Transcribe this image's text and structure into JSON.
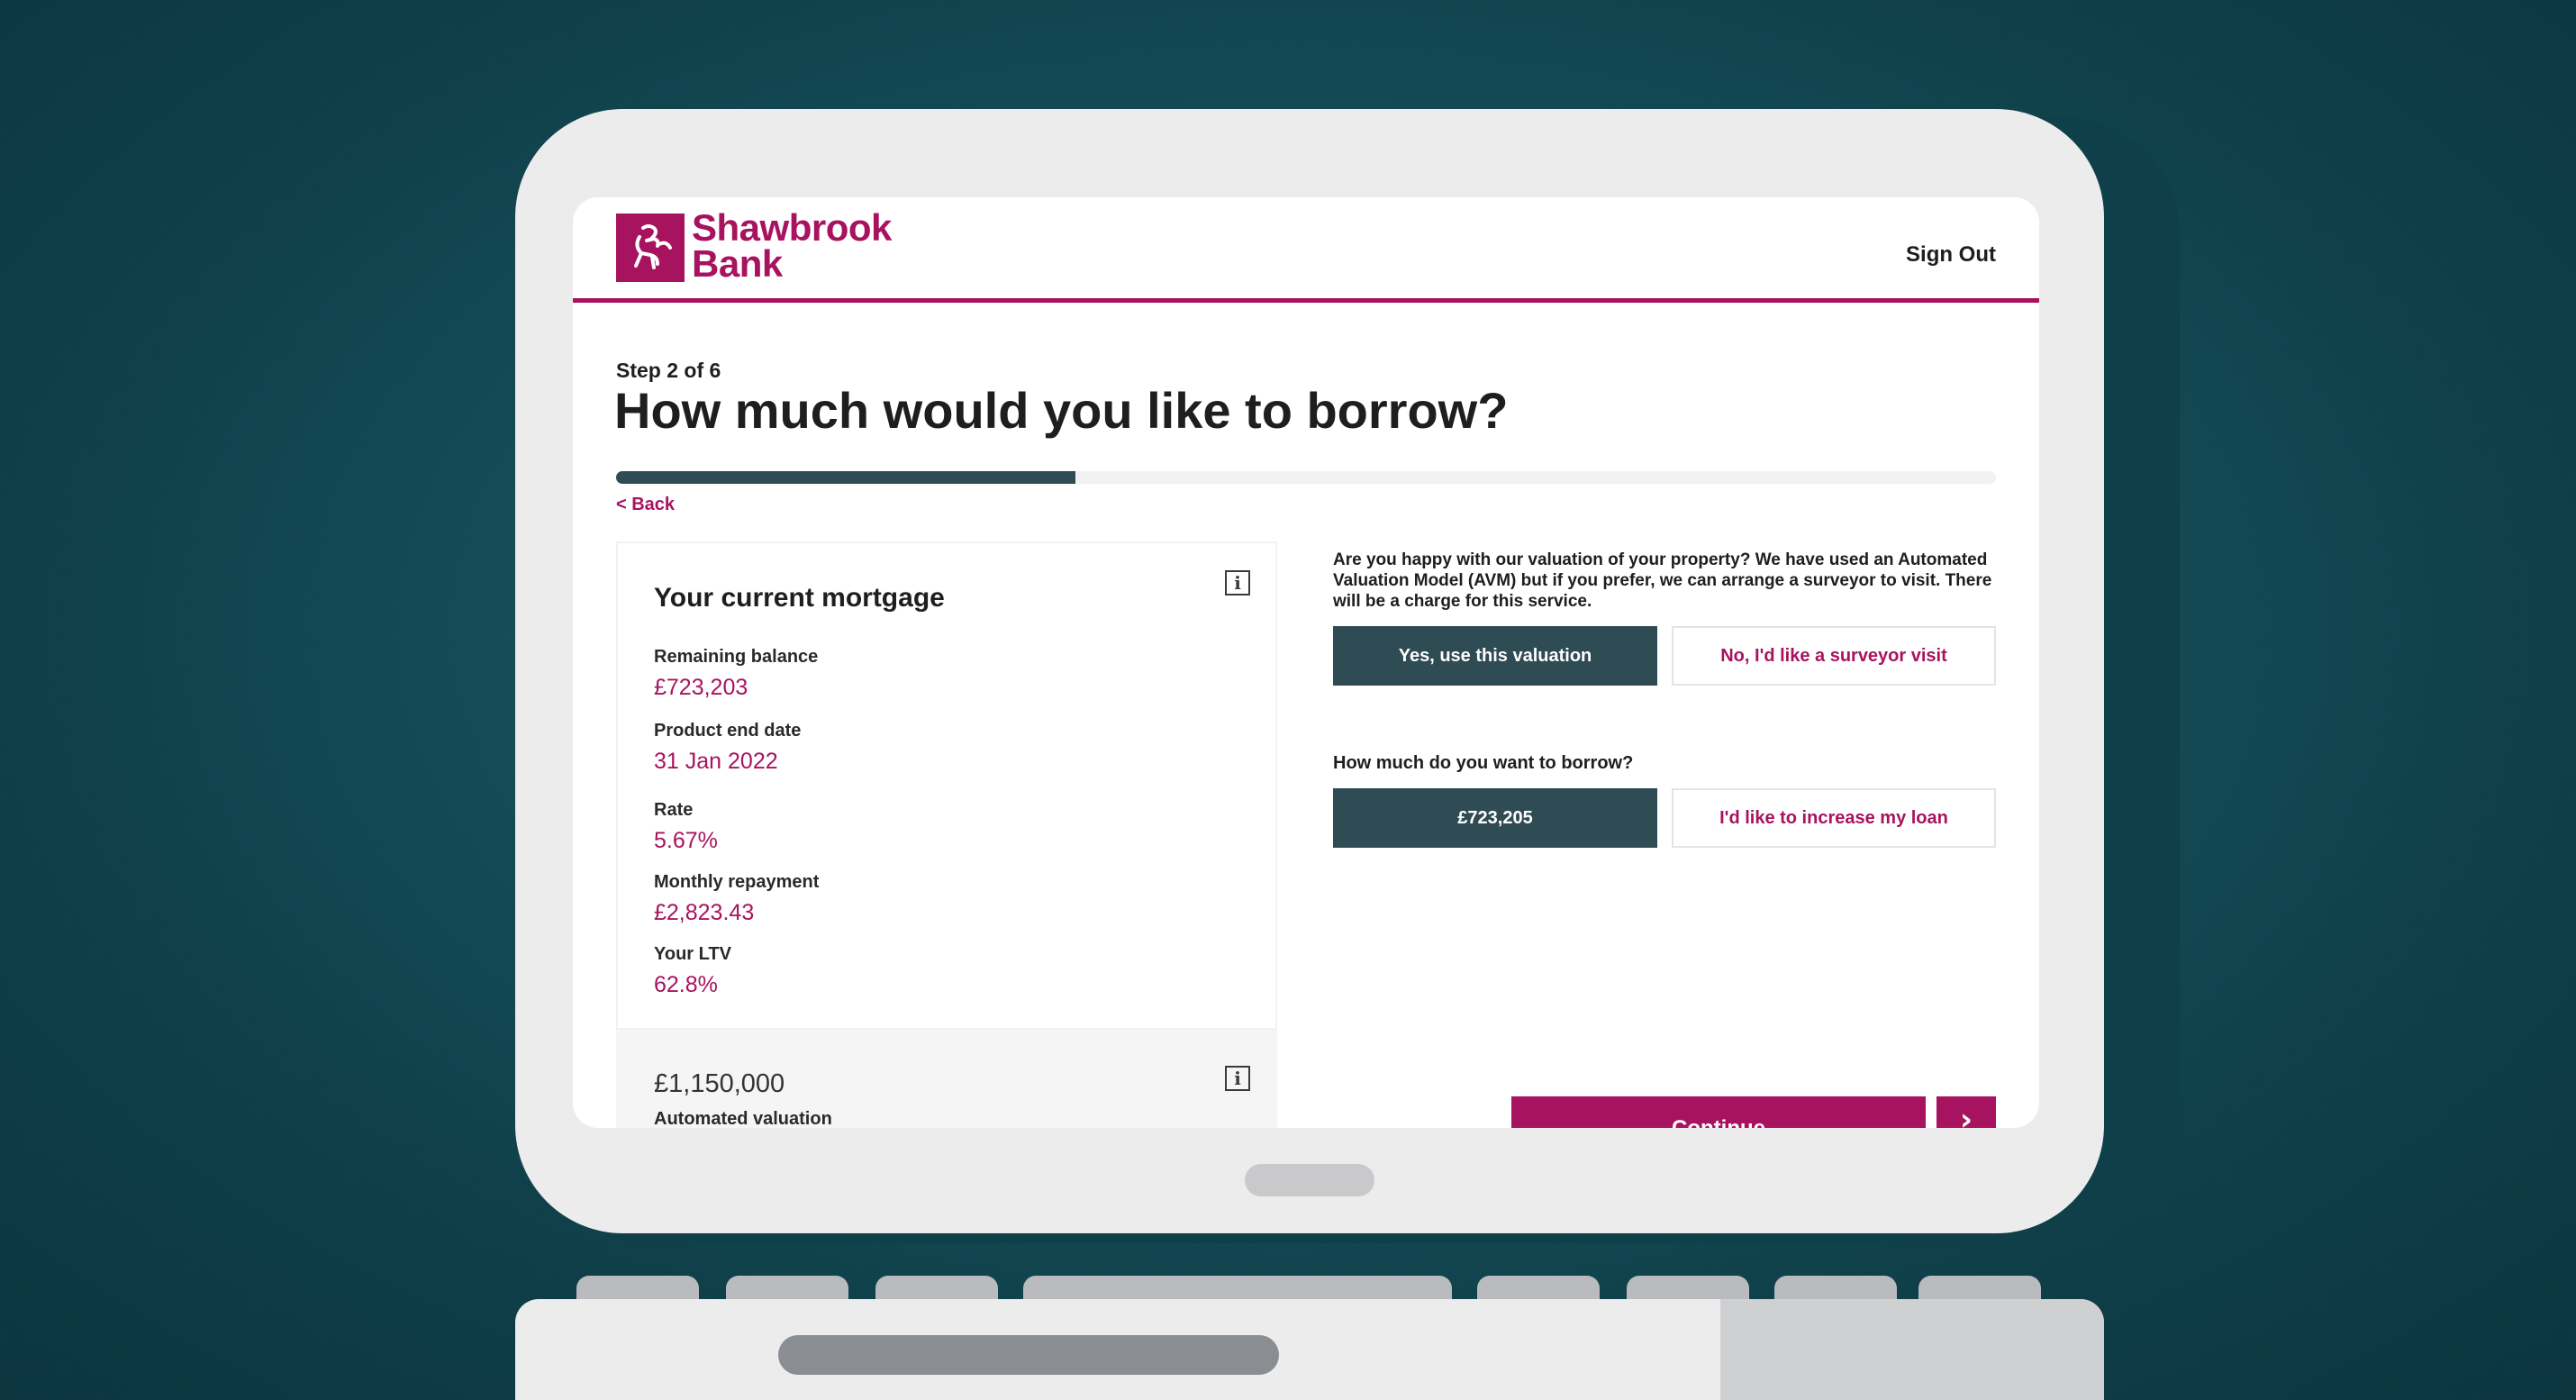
{
  "brand": {
    "name_line1": "Shawbrook",
    "name_line2": "Bank",
    "color": "#a8135f"
  },
  "header": {
    "sign_out": "Sign Out"
  },
  "step": {
    "label": "Step 2 of 6",
    "title": "How much would you like to borrow?",
    "progress": 0.333
  },
  "nav": {
    "back": "< Back"
  },
  "mortgage_card": {
    "title": "Your current mortgage",
    "info_icon": "info-icon",
    "fields": [
      {
        "label": "Remaining balance",
        "value": "£723,203"
      },
      {
        "label": "Product end date",
        "value": "31 Jan 2022"
      },
      {
        "label": "Rate",
        "value": "5.67%"
      },
      {
        "label": "Monthly repayment",
        "value": "£2,823.43"
      },
      {
        "label": "Your LTV",
        "value": "62.8%"
      }
    ]
  },
  "valuation": {
    "amount": "£1,150,000",
    "label": "Automated valuation",
    "info_icon": "info-icon"
  },
  "valuation_question": {
    "text": "Are you happy with our valuation of your property? We have used an Automated Valuation Model (AVM) but if you prefer, we can arrange a surveyor to visit. There will be a charge for this service.",
    "yes_button": "Yes, use this valuation",
    "no_button": "No, I'd like a surveyor visit"
  },
  "borrow_question": {
    "text": "How much do you want to borrow?",
    "amount_button": "£723,205",
    "increase_button": "I'd like to increase my loan"
  },
  "footer": {
    "continue_button": "Continue",
    "arrow_icon": "chevron-right-icon"
  },
  "colors": {
    "background": "#17505a",
    "accent": "#a8135f",
    "dark_button": "#2f4b53",
    "laptop_body": "#ececed"
  }
}
